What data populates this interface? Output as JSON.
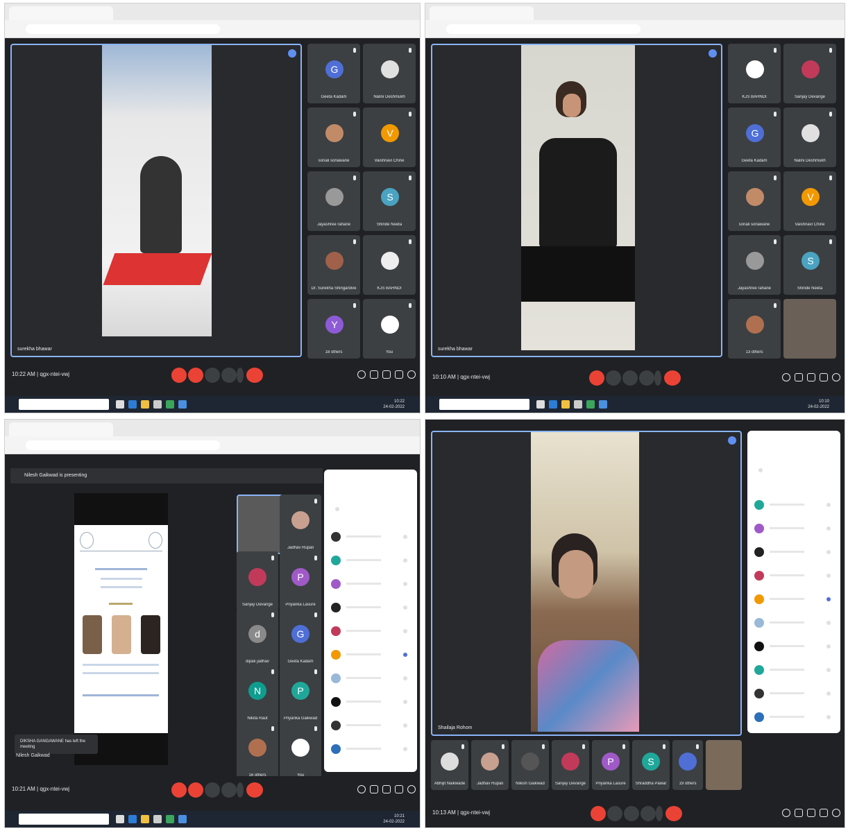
{
  "panels": {
    "p1": {
      "time_code": "10:22 AM | qgx-ntei-vwj",
      "speaker": "surekha bhawar",
      "tiles": [
        "Geeta Kadam",
        "Nalini Deshmukh",
        "sonali sonawane",
        "Vaishnavi Chine",
        "Jayashree rahane",
        "Shinde Neeta",
        "Dr. Surekha Shingardive",
        "KJS BAHNDI",
        "18 others",
        "You"
      ],
      "clock": "10:22\n24-02-2022"
    },
    "p2": {
      "time_code": "10:10 AM | qgx-ntei-vwj",
      "speaker": "surekha bhawar",
      "tiles": [
        "KJS BAHNDI",
        "Sanjay Devange",
        "Geeta Kadam",
        "Nalini Deshmukh",
        "sonali sonawane",
        "Vaishnavi Chine",
        "Jayashree rahane",
        "Shinde Neeta",
        "13 others"
      ],
      "clock": "10:10\n24-02-2022"
    },
    "p3": {
      "banner": "Nilesh Gaikwad is presenting",
      "time_code": "10:21 AM | qgx-ntei-vwj",
      "toast": "DIKSHA GANGAWANE has left the meeting",
      "presenter": "Nilesh Gaikwad",
      "tiles": [
        "Jadhav Rupali",
        "Sanjay Devange",
        "Priyanka Lasure",
        "dipak jadhav",
        "Geeta Kadam",
        "Nikita Raut",
        "Priyanka Gaikwad",
        "16 others",
        "You"
      ],
      "clock": "10:21\n24-02-2022"
    },
    "p4": {
      "speaker": "Shailaja Rohom",
      "time_code": "10:13 AM | qgx-ntei-vwj",
      "tiles": [
        "Abhijit Naikwade",
        "Jadhav Rupali",
        "Nilesh Gaikwad",
        "Sanjay Devange",
        "Priyanka Lasure",
        "Shraddha Pawar",
        "19 others"
      ]
    }
  },
  "colors": {
    "meet_dark": "#202124",
    "tile": "#3c4043",
    "end_red": "#ea4335",
    "highlight": "#8ab4f8"
  }
}
